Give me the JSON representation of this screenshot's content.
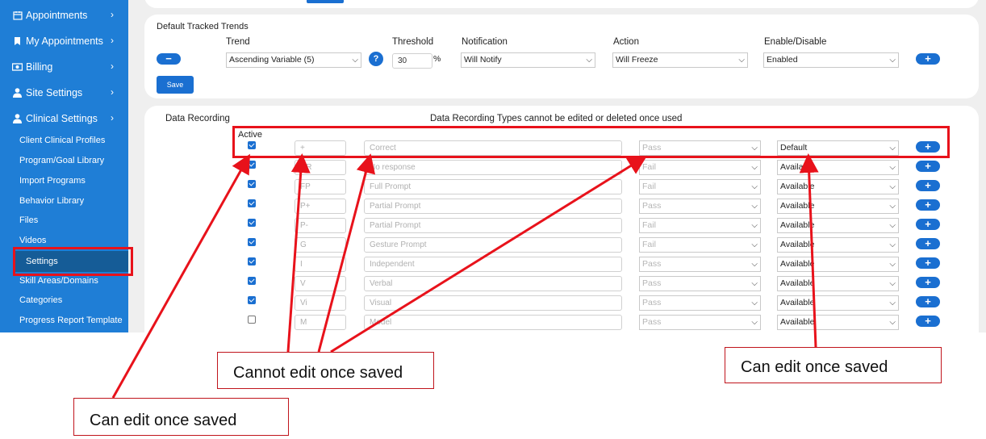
{
  "sidebar": {
    "main_items": [
      {
        "label": "Appointments",
        "icon": "calendar-icon"
      },
      {
        "label": "My Appointments",
        "icon": "bookmark-icon"
      },
      {
        "label": "Billing",
        "icon": "money-icon"
      },
      {
        "label": "Site Settings",
        "icon": "user-icon"
      },
      {
        "label": "Clinical Settings",
        "icon": "user-icon"
      }
    ],
    "chevron": "›",
    "sub_items": [
      "Client Clinical Profiles",
      "Program/Goal Library",
      "Import Programs",
      "Behavior Library",
      "Files",
      "Videos",
      "Settings",
      "Skill Areas/Domains",
      "Categories",
      "Progress Report Template"
    ],
    "active_item": "Settings"
  },
  "trends": {
    "title": "Default Tracked Trends",
    "headers": {
      "trend": "Trend",
      "threshold": "Threshold",
      "notification": "Notification",
      "action": "Action",
      "enable": "Enable/Disable"
    },
    "trend_value": "Ascending Variable (5)",
    "help_label": "?",
    "threshold_value": "30",
    "percent": "%",
    "notification_value": "Will Notify",
    "action_value": "Will Freeze",
    "enable_value": "Enabled",
    "remove_label": "−",
    "add_label": "+",
    "save_label": "Save"
  },
  "recording": {
    "title": "Data Recording",
    "notice": "Data Recording Types cannot be edited or deleted once used",
    "active_header": "Active",
    "add_label": "+",
    "caret": "⌵",
    "rows": [
      {
        "active": true,
        "code": "+",
        "name": "Correct",
        "result": "Pass",
        "status": "Default"
      },
      {
        "active": true,
        "code": "NR",
        "name": "No response",
        "result": "Fail",
        "status": "Available"
      },
      {
        "active": true,
        "code": "FP",
        "name": "Full Prompt",
        "result": "Fail",
        "status": "Available"
      },
      {
        "active": true,
        "code": "P+",
        "name": "Partial Prompt",
        "result": "Pass",
        "status": "Available"
      },
      {
        "active": true,
        "code": "P-",
        "name": "Partial Prompt",
        "result": "Fail",
        "status": "Available"
      },
      {
        "active": true,
        "code": "G",
        "name": "Gesture Prompt",
        "result": "Fail",
        "status": "Available"
      },
      {
        "active": true,
        "code": "I",
        "name": "Independent",
        "result": "Pass",
        "status": "Available"
      },
      {
        "active": true,
        "code": "V",
        "name": "Verbal",
        "result": "Pass",
        "status": "Available"
      },
      {
        "active": true,
        "code": "Vi",
        "name": "Visual",
        "result": "Pass",
        "status": "Available"
      },
      {
        "active": false,
        "code": "M",
        "name": "Model",
        "result": "Pass",
        "status": "Available"
      }
    ]
  },
  "annotations": {
    "cannot_edit": "Cannot edit once saved",
    "can_edit_left": "Can edit once saved",
    "can_edit_right": "Can edit once saved",
    "color": "#e8121b"
  },
  "colors": {
    "sidebar": "#1f7ed6",
    "sidebar_active": "#155c97",
    "accent": "#1a6fd1",
    "page_bg": "#efefef"
  }
}
